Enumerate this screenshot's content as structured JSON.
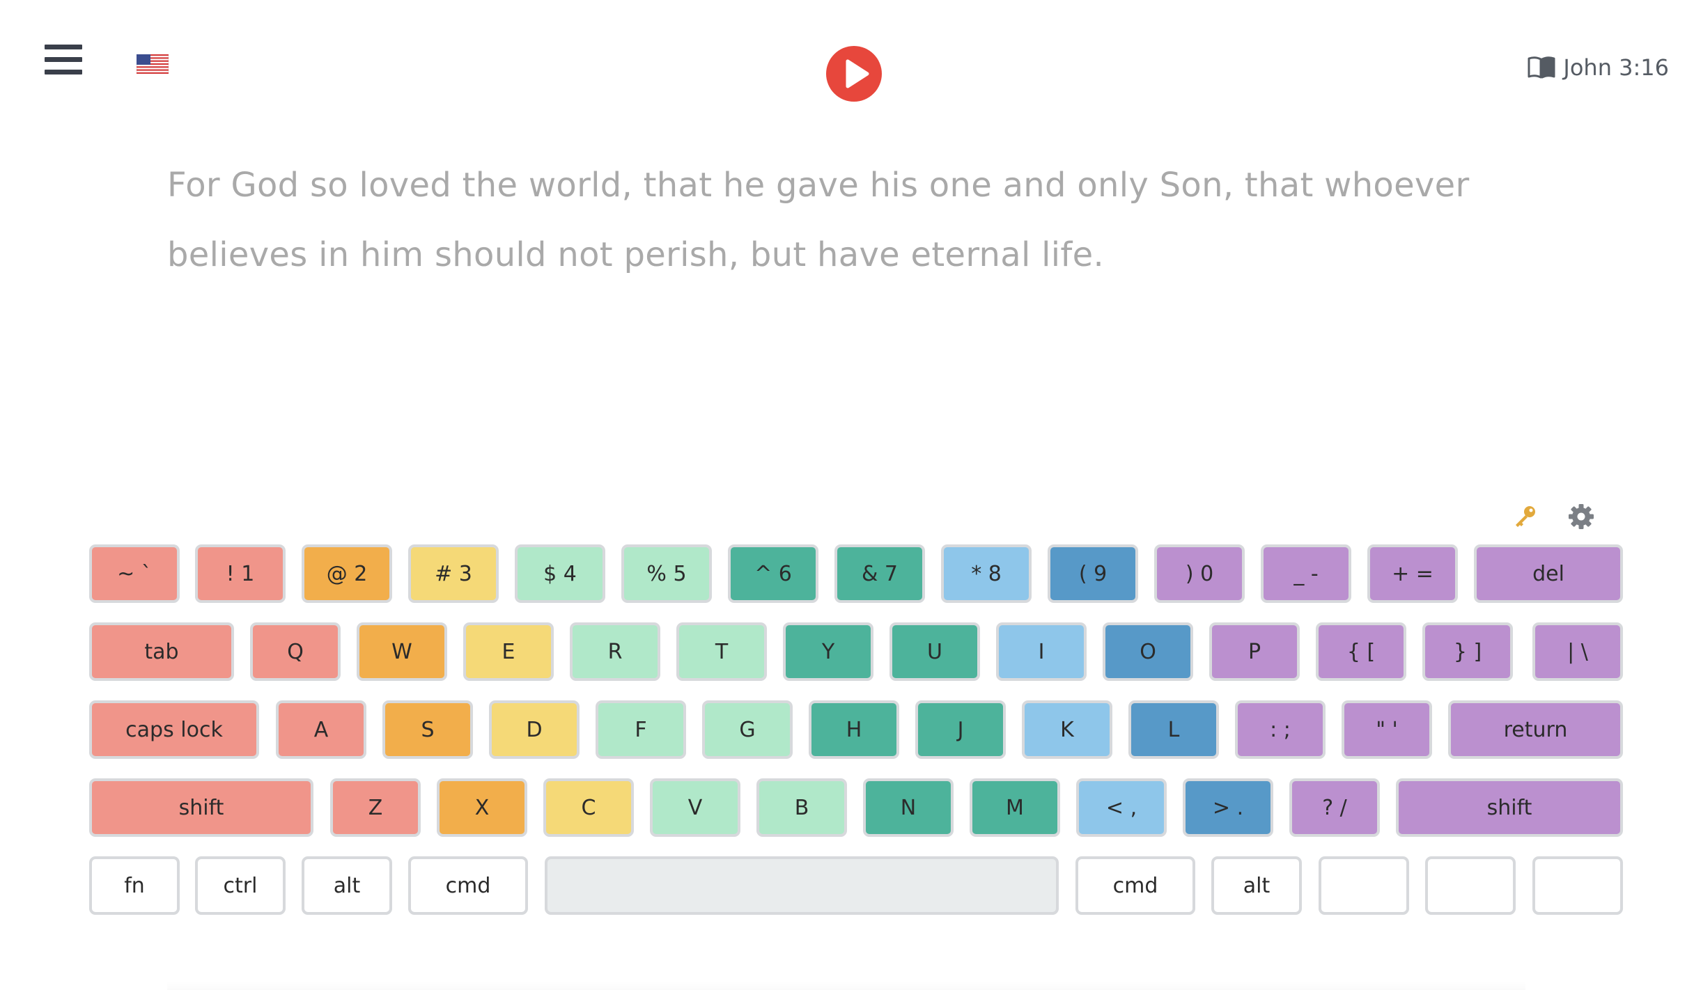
{
  "header": {
    "reference": "John 3:16",
    "play_color": "#e7473c"
  },
  "verse": {
    "text": "For God so loved the world, that he gave his one and only Son, that whoever believes in him should not perish, but have eternal life."
  },
  "palette": {
    "left_pinky": "#f0958a",
    "left_ring": "#f2ae4b",
    "left_middle": "#f5d977",
    "left_index": "#b0e8c9",
    "right_index": "#4db39b",
    "right_middle": "#8ec6ea",
    "right_ring": "#5799c8",
    "right_pinky": "#bb90cf"
  },
  "keyboard": {
    "row1": [
      "~ `",
      "! 1",
      "@ 2",
      "# 3",
      "$ 4",
      "% 5",
      "^ 6",
      "& 7",
      "* 8",
      "( 9",
      ") 0",
      "_ -",
      "+ =",
      "del"
    ],
    "row2": [
      "tab",
      "Q",
      "W",
      "E",
      "R",
      "T",
      "Y",
      "U",
      "I",
      "O",
      "P",
      "{ [",
      "} ]",
      "| \\"
    ],
    "row3": [
      "caps lock",
      "A",
      "S",
      "D",
      "F",
      "G",
      "H",
      "J",
      "K",
      "L",
      ": ;",
      "\" '",
      "return"
    ],
    "row4": [
      "shift",
      "Z",
      "X",
      "C",
      "V",
      "B",
      "N",
      "M",
      "< ,",
      "> .",
      "? /",
      "shift"
    ],
    "row5": [
      "fn",
      "ctrl",
      "alt",
      "cmd",
      "",
      "cmd",
      "alt",
      "",
      "",
      ""
    ]
  }
}
